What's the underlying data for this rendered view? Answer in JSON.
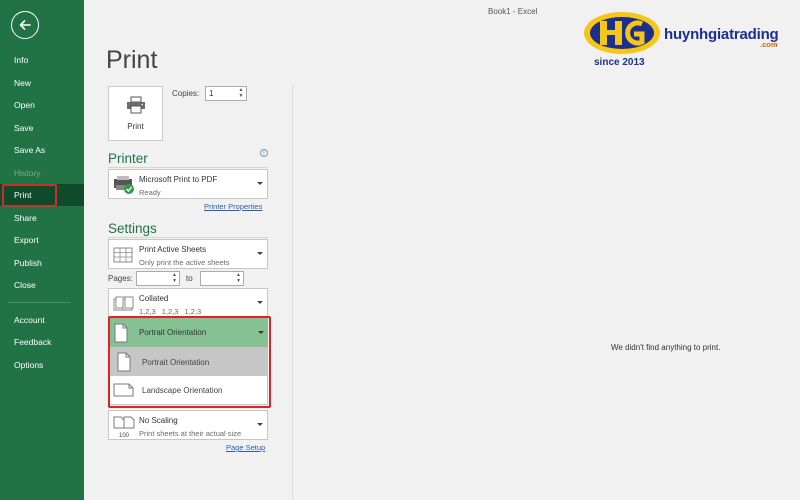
{
  "window": {
    "title": "Book1 - Excel"
  },
  "sidebar": {
    "items": [
      {
        "label": "Info",
        "state": "normal"
      },
      {
        "label": "New",
        "state": "normal"
      },
      {
        "label": "Open",
        "state": "normal"
      },
      {
        "label": "Save",
        "state": "normal"
      },
      {
        "label": "Save As",
        "state": "normal"
      },
      {
        "label": "History",
        "state": "disabled"
      },
      {
        "label": "Print",
        "state": "active"
      },
      {
        "label": "Share",
        "state": "normal"
      },
      {
        "label": "Export",
        "state": "normal"
      },
      {
        "label": "Publish",
        "state": "normal"
      },
      {
        "label": "Close",
        "state": "normal"
      },
      {
        "label": "Account",
        "state": "normal"
      },
      {
        "label": "Feedback",
        "state": "normal"
      },
      {
        "label": "Options",
        "state": "normal"
      }
    ],
    "back_icon": "back-arrow-icon"
  },
  "print": {
    "title": "Print",
    "button_label": "Print",
    "copies_label": "Copies:",
    "copies_value": "1"
  },
  "printer": {
    "heading": "Printer",
    "name": "Microsoft Print to PDF",
    "status": "Ready",
    "properties_link": "Printer Properties"
  },
  "settings": {
    "heading": "Settings",
    "scope_title": "Print Active Sheets",
    "scope_sub": "Only print the active sheets",
    "pages_label": "Pages:",
    "to_label": "to",
    "pages_from": "",
    "pages_to": "",
    "collation_title": "Collated",
    "collation_sub": "1,2,3    1,2,3    1,2,3",
    "orientation_selected": "Portrait Orientation",
    "orientation_options": [
      "Portrait Orientation",
      "Landscape Orientation"
    ],
    "scaling_title": "No Scaling",
    "scaling_sub": "Print sheets at their actual size",
    "page_setup_link": "Page Setup"
  },
  "preview": {
    "message": "We didn't find anything to print."
  },
  "logo": {
    "name": "huynhgiatrading",
    "domain": ".com",
    "since": "since 2013"
  },
  "colors": {
    "accent": "#217346",
    "selected": "#86c194",
    "highlight": "#d72626",
    "logo_blue": "#1c2f8f",
    "logo_yellow": "#f5c518"
  }
}
